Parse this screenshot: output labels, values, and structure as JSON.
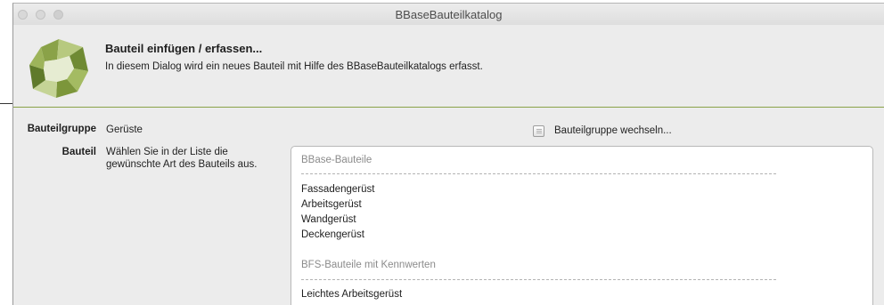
{
  "window": {
    "title": "BBaseBauteilkatalog"
  },
  "header": {
    "title": "Bauteil einfügen / erfassen...",
    "description": "In diesem Dialog wird ein neues Bauteil mit Hilfe des BBaseBauteilkatalogs erfasst.",
    "logo_icon": "bbase-logo-icon",
    "accent_color": "#8aa248"
  },
  "form": {
    "group_label": "Bauteilgruppe",
    "group_value": "Gerüste",
    "switch_label": "Bauteilgruppe wechseln...",
    "part_label": "Bauteil",
    "part_hint_line1": "Wählen Sie in der Liste die",
    "part_hint_line2": "gewünschte Art des Bauteils aus."
  },
  "list": {
    "group1_title": "BBase-Bauteile",
    "group1_items": [
      "Fassadengerüst",
      "Arbeitsgerüst",
      "Wandgerüst",
      "Deckengerüst"
    ],
    "group2_title": "BFS-Bauteile mit Kennwerten",
    "group2_items": [
      "Leichtes Arbeitsgerüst"
    ]
  }
}
